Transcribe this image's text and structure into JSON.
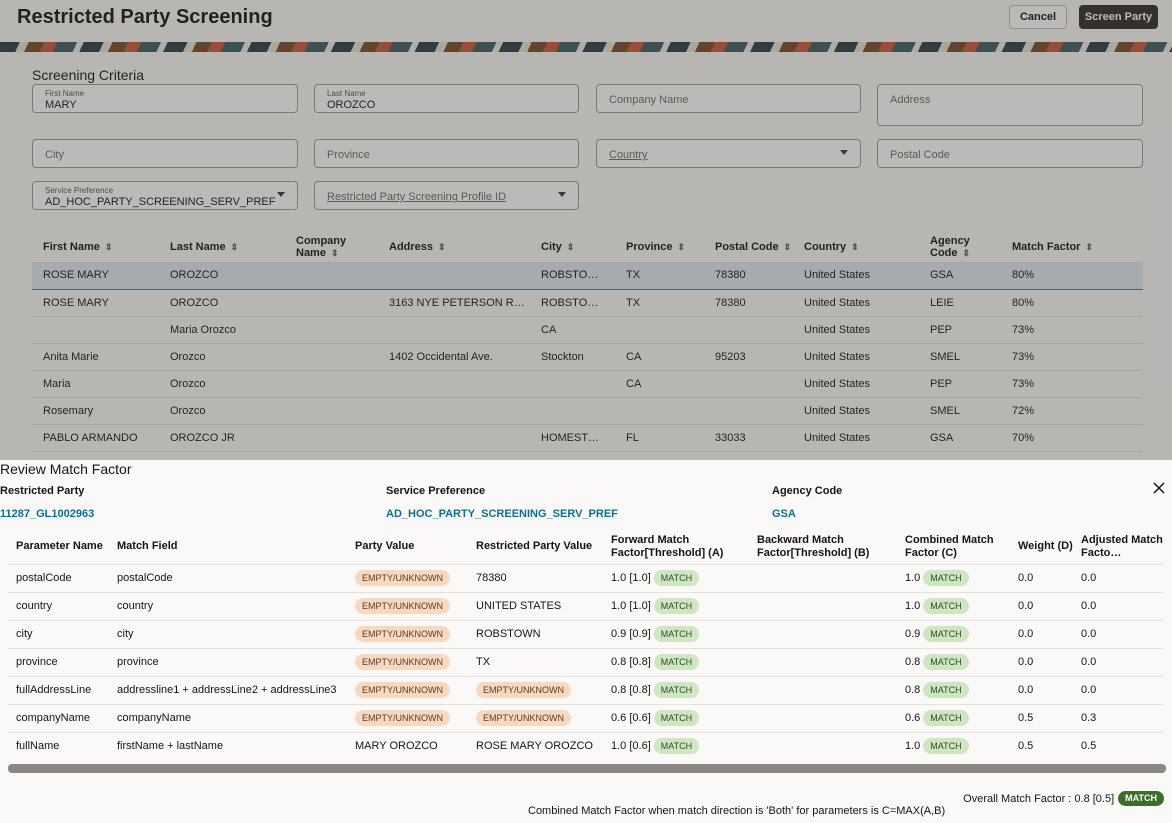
{
  "page": {
    "title": "Restricted Party Screening",
    "cancel_label": "Cancel",
    "screen_label": "Screen Party"
  },
  "criteria": {
    "title": "Screening Criteria",
    "first_name": {
      "label": "First Name",
      "value": "MARY"
    },
    "last_name": {
      "label": "Last Name",
      "value": "OROZCO"
    },
    "company_name": {
      "placeholder": "Company Name"
    },
    "address": {
      "placeholder": "Address"
    },
    "city": {
      "placeholder": "City"
    },
    "province": {
      "placeholder": "Province"
    },
    "country": {
      "placeholder": "Country"
    },
    "postal_code": {
      "placeholder": "Postal Code"
    },
    "service_preference": {
      "label": "Service Preference",
      "value": "AD_HOC_PARTY_SCREENING_SERV_PREF"
    },
    "profile_id": {
      "placeholder": "Restricted Party Screening Profile ID"
    }
  },
  "results": {
    "columns": [
      "First Name",
      "Last Name",
      "Company Name",
      "Address",
      "City",
      "Province",
      "Postal Code",
      "Country",
      "Agency Code",
      "Match Factor"
    ],
    "rows": [
      [
        "ROSE MARY",
        "OROZCO",
        "",
        "",
        "ROBSTO…",
        "TX",
        "78380",
        "United States",
        "GSA",
        "80%"
      ],
      [
        "ROSE MARY",
        "OROZCO",
        "",
        "3163 NYE PETERSON R…",
        "ROBSTO…",
        "TX",
        "78380",
        "United States",
        "LEIE",
        "80%"
      ],
      [
        "",
        "Maria Orozco",
        "",
        "",
        "CA",
        "",
        "",
        "United States",
        "PEP",
        "73%"
      ],
      [
        "Anita Marie",
        "Orozco",
        "",
        "1402 Occidental Ave.",
        "Stockton",
        "CA",
        "95203",
        "United States",
        "SMEL",
        "73%"
      ],
      [
        "Maria",
        "Orozco",
        "",
        "",
        "",
        "CA",
        "",
        "United States",
        "PEP",
        "73%"
      ],
      [
        "Rosemary",
        "Orozco",
        "",
        "",
        "",
        "",
        "",
        "United States",
        "SMEL",
        "72%"
      ],
      [
        "PABLO ARMANDO",
        "OROZCO JR",
        "",
        "",
        "HOMEST…",
        "FL",
        "33033",
        "United States",
        "GSA",
        "70%"
      ]
    ]
  },
  "drawer": {
    "title": "Review Match Factor",
    "restricted_party_label": "Restricted Party",
    "restricted_party_value": "11287_GL1002963",
    "service_preference_label": "Service Preference",
    "service_preference_value": "AD_HOC_PARTY_SCREENING_SERV_PREF",
    "agency_code_label": "Agency Code",
    "agency_code_value": "GSA",
    "columns": [
      "Parameter Name",
      "Match Field",
      "Party Value",
      "Restricted Party Value",
      "Forward Match Factor[Threshold] (A)",
      "Backward Match Factor[Threshold] (B)",
      "Combined Match Factor (C)",
      "Weight (D)",
      "Adjusted Match Facto…"
    ],
    "match_label": "MATCH",
    "empty_label": "EMPTY/UNKNOWN",
    "rows": [
      {
        "param": "postalCode",
        "field": "postalCode",
        "party": "EMPTY/UNKNOWN",
        "rp": "78380",
        "fwd": "1.0 [1.0]",
        "bwd": "",
        "comb": "1.0",
        "weight": "0.0",
        "adj": "0.0"
      },
      {
        "param": "country",
        "field": "country",
        "party": "EMPTY/UNKNOWN",
        "rp": "UNITED STATES",
        "fwd": "1.0 [1.0]",
        "bwd": "",
        "comb": "1.0",
        "weight": "0.0",
        "adj": "0.0"
      },
      {
        "param": "city",
        "field": "city",
        "party": "EMPTY/UNKNOWN",
        "rp": "ROBSTOWN",
        "fwd": "0.9 [0.9]",
        "bwd": "",
        "comb": "0.9",
        "weight": "0.0",
        "adj": "0.0"
      },
      {
        "param": "province",
        "field": "province",
        "party": "EMPTY/UNKNOWN",
        "rp": "TX",
        "fwd": "0.8 [0.8]",
        "bwd": "",
        "comb": "0.8",
        "weight": "0.0",
        "adj": "0.0"
      },
      {
        "param": "fullAddressLine",
        "field": "addressline1 + addressLine2 + addressLine3",
        "party": "EMPTY/UNKNOWN",
        "rp": "EMPTY/UNKNOWN",
        "fwd": "0.8 [0.8]",
        "bwd": "",
        "comb": "0.8",
        "weight": "0.0",
        "adj": "0.0"
      },
      {
        "param": "companyName",
        "field": "companyName",
        "party": "EMPTY/UNKNOWN",
        "rp": "EMPTY/UNKNOWN",
        "fwd": "0.6 [0.6]",
        "bwd": "",
        "comb": "0.6",
        "weight": "0.5",
        "adj": "0.3"
      },
      {
        "param": "fullName",
        "field": "firstName + lastName",
        "party": "MARY OROZCO",
        "rp": "ROSE MARY OROZCO",
        "fwd": "1.0 [0.6]",
        "bwd": "",
        "comb": "1.0",
        "weight": "0.5",
        "adj": "0.5"
      }
    ],
    "overall_label": "Overall Match Factor : 0.8 [0.5]",
    "overall_status": "MATCH",
    "note": "Combined Match Factor when match direction is 'Both' for parameters is C=MAX(A,B)"
  }
}
